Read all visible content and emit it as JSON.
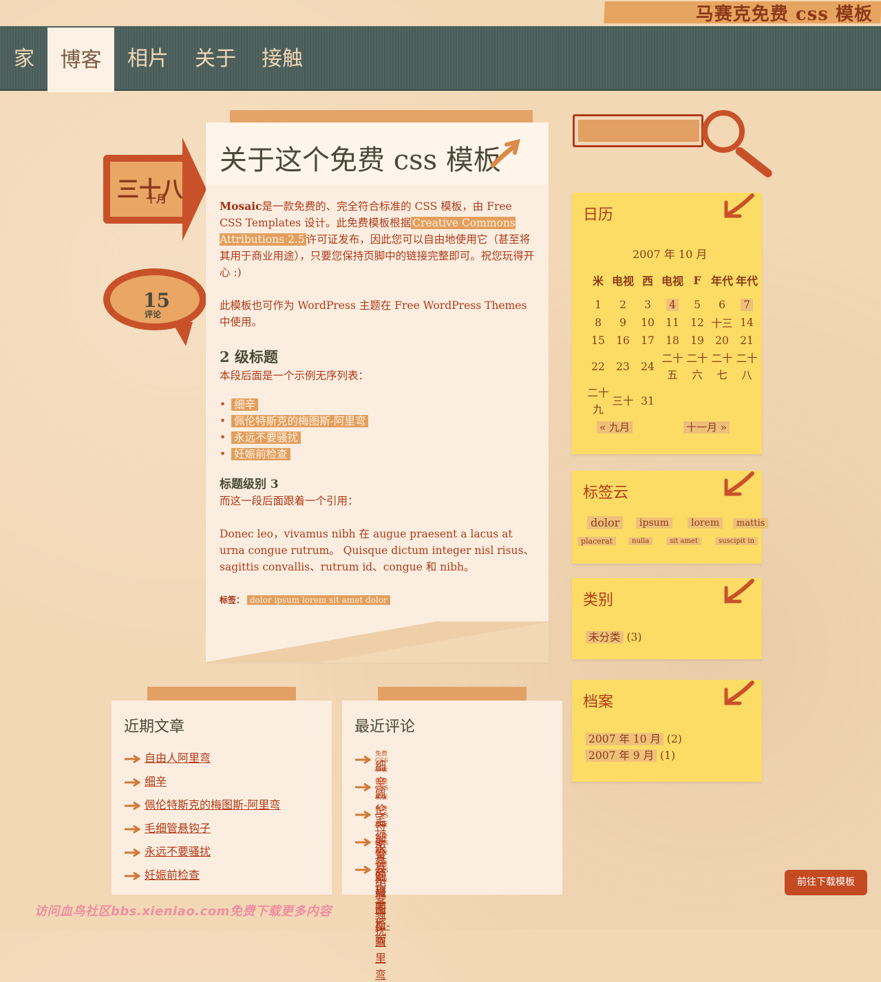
{
  "site": {
    "title": "马赛克免费 css 模板"
  },
  "nav": {
    "items": [
      "家",
      "博客",
      "相片",
      "关于",
      "接触"
    ],
    "active": "博客"
  },
  "post": {
    "date_day": "三十八",
    "date_month": "十月",
    "comment_count": "15",
    "comment_label": "评论",
    "title": "关于这个免费 css 模板",
    "p1_strong": "Mosaic",
    "p1_a": "是一款免费的、完全符合标准的 CSS 模板，由 Free CSS Templates 设计。此免费模板根据",
    "p1_link": "Creative Commons Attributions 2.5",
    "p1_b": "许可证发布，因此您可以自由地使用它（甚至将其用于商业用途），只要您保持页脚中的链接完整即可。祝您玩得开心 :)",
    "p2": "此模板也可作为 WordPress 主题在 Free WordPress Themes 中使用。",
    "h2": "2 级标题",
    "h2_text": "本段后面是一个示例无序列表：",
    "list": [
      "细辛",
      "佩伦特斯克的梅图斯-阿里弯",
      "永远不要骚扰",
      "妊娠前检查"
    ],
    "h3": "标题级别 3",
    "h3_text": "而这一段后面跟着一个引用：",
    "quote": "Donec leo，vivamus nibh 在 augue praesent a lacus at urna congue rutrum。 Quisque dictum integer nisl risus、sagittis convallis、rutrum id、congue 和 nibh。",
    "tags_label": "标签：",
    "tags": "dolor  ipsum  lorem  sit amet  dolor"
  },
  "recent_posts": {
    "title": "近期文章",
    "items": [
      "自由人阿里弯",
      "细辛",
      "佩伦特斯克的梅图斯-阿里弯",
      "毛细管悬钩子",
      "永远不要骚扰",
      "妊娠前检查"
    ]
  },
  "recent_comments": {
    "title": "最近评论",
    "source": "免费 CSS 模板",
    "items": [
      "细辛",
      "佩伦特斯克的梅图斯-阿里弯",
      "毛细管悬钩子",
      "永远不要骚扰",
      "妊娠前检查"
    ]
  },
  "calendar": {
    "title": "日历",
    "caption": "2007 年 10 月",
    "headers": [
      "米",
      "电视",
      "西",
      "电视",
      "F",
      "年代",
      "年代"
    ],
    "rows": [
      [
        "1",
        "2",
        "3",
        "4",
        "5",
        "6",
        "7"
      ],
      [
        "8",
        "9",
        "10",
        "11",
        "12",
        "十三",
        "14"
      ],
      [
        "15",
        "16",
        "17",
        "18",
        "19",
        "20",
        "21"
      ],
      [
        "22",
        "23",
        "24",
        "二十五",
        "二十六",
        "二十七",
        "二十八"
      ],
      [
        "二十九",
        "三十",
        "31",
        "",
        "",
        "",
        ""
      ]
    ],
    "prev": "« 九月",
    "next": "十一月 »"
  },
  "tagcloud": {
    "title": "标签云",
    "row1": [
      "dolor",
      "ipsum",
      "lorem",
      "mattis"
    ],
    "row2": [
      "placerat",
      "nulla",
      "sit amet",
      "suscipit in"
    ]
  },
  "categories": {
    "title": "类别",
    "item": "未分类",
    "count": "(3)"
  },
  "archives": {
    "title": "档案",
    "items": [
      {
        "label": "2007 年 10 月",
        "count": "(2)"
      },
      {
        "label": "2007 年 9 月",
        "count": "(1)"
      }
    ]
  },
  "footer": {
    "note": "访问血鸟社区bbs.xieniao.com免费下载更多内容",
    "download_button": "前往下载模板"
  }
}
